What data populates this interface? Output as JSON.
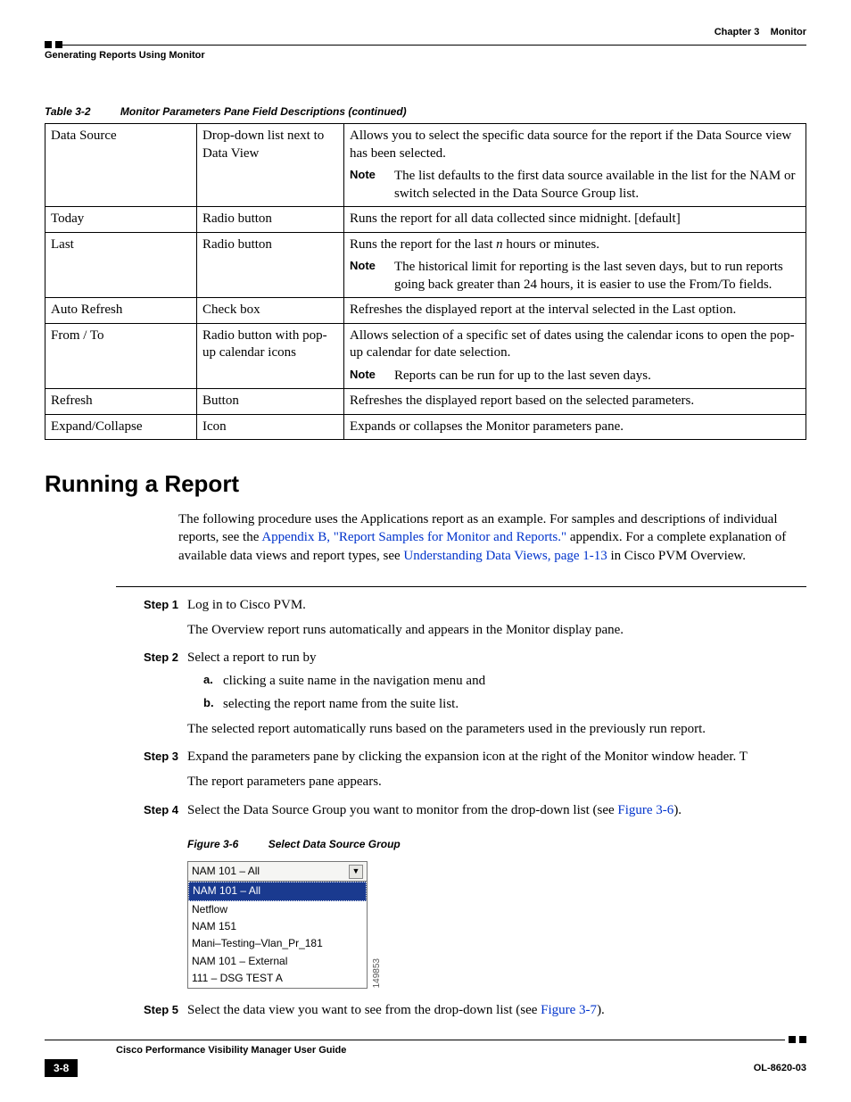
{
  "header": {
    "chapter_label": "Chapter 3",
    "chapter_title": "Monitor",
    "section_title": "Generating Reports Using Monitor"
  },
  "table": {
    "number": "Table 3-2",
    "title": "Monitor Parameters Pane Field Descriptions (continued)",
    "note_label": "Note",
    "rows": [
      {
        "field": "Data Source",
        "control": "Drop-down list next to Data View",
        "desc": "Allows you to select the specific data source for the report if the Data Source view has been selected.",
        "note": "The list defaults to the first data source available in the list for the NAM or switch selected in the Data Source Group list."
      },
      {
        "field": "Today",
        "control": "Radio button",
        "desc": "Runs the report for all data collected since midnight. [default]"
      },
      {
        "field": "Last",
        "control": "Radio button",
        "desc_pre": "Runs the report for the last ",
        "desc_ital": "n",
        "desc_post": " hours or minutes.",
        "note": "The historical limit for reporting is the last seven days, but to run reports going back greater than 24 hours, it is easier to use the From/To fields."
      },
      {
        "field": "Auto Refresh",
        "control": "Check box",
        "desc": "Refreshes the displayed report at the interval selected in the Last option."
      },
      {
        "field": "From / To",
        "control": "Radio button with pop-up calendar icons",
        "desc": "Allows selection of a specific set of dates using the calendar icons to open the pop-up calendar for date selection.",
        "note": "Reports can be run for up to the last seven days."
      },
      {
        "field": "Refresh",
        "control": "Button",
        "desc": "Refreshes the displayed report based on the selected parameters."
      },
      {
        "field": "Expand/Collapse",
        "control": "Icon",
        "desc": "Expands or collapses the Monitor parameters pane."
      }
    ]
  },
  "section_heading": "Running a Report",
  "intro": {
    "p1a": "The following procedure uses the Applications report as an example. For samples and descriptions of individual reports, see the ",
    "link1": "Appendix B, \"Report Samples for Monitor and Reports.\"",
    "p1b": " appendix. For a complete explanation of available data views and report types, see ",
    "link2": "Understanding Data Views, page 1-13",
    "p1c": " in Cisco PVM Overview."
  },
  "steps": {
    "labels": {
      "s1": "Step 1",
      "s2": "Step 2",
      "s3": "Step 3",
      "s4": "Step 4",
      "s5": "Step 5",
      "a": "a.",
      "b": "b."
    },
    "s1a": "Log in to Cisco PVM.",
    "s1b": "The Overview report runs automatically and appears in the Monitor display pane.",
    "s2a": "Select a report to run by",
    "s2sub_a": "clicking a suite name in the navigation menu and",
    "s2sub_b": "selecting the report name from the suite list.",
    "s2b": "The selected report automatically runs based on the parameters used in the previously run report.",
    "s3a": "Expand the parameters pane by clicking the expansion icon at the right of the Monitor window header. T",
    "s3b": "The report parameters pane appears.",
    "s4a_pre": "Select the Data Source Group you want to monitor from the drop-down list (see ",
    "s4a_link": "Figure 3-6",
    "s4a_post": ").",
    "s5_pre": "Select the data view you want to see from the drop-down list (see ",
    "s5_link": "Figure 3-7",
    "s5_post": ")."
  },
  "figure": {
    "number": "Figure 3-6",
    "title": "Select Data Source Group",
    "selected": "NAM 101 – All",
    "highlighted": "NAM 101 – All",
    "items": [
      "Netflow",
      "NAM 151",
      "Mani–Testing–Vlan_Pr_181",
      "NAM 101 – External",
      "111 – DSG TEST A"
    ],
    "code": "149853"
  },
  "footer": {
    "guide": "Cisco Performance Visibility Manager User Guide",
    "page": "3-8",
    "docid": "OL-8620-03"
  }
}
